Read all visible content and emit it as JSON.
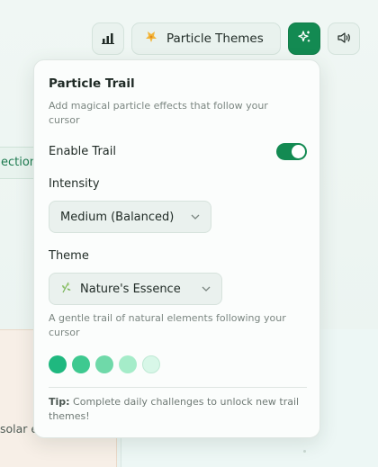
{
  "toolbar": {
    "theme_button_label": "Particle Themes",
    "icons": {
      "stats": "bar-chart-icon",
      "theme": "sparkle-star-icon",
      "particles": "magic-sparkles-icon",
      "sound": "speaker-icon"
    }
  },
  "background": {
    "pill_text": "ection",
    "body_snippet": "solar e"
  },
  "popover": {
    "title": "Particle Trail",
    "description": "Add magical particle effects that follow your cursor",
    "enable_label": "Enable Trail",
    "enable_on": true,
    "intensity_label": "Intensity",
    "intensity_value": "Medium (Balanced)",
    "theme_label": "Theme",
    "theme_value": "Nature's Essence",
    "theme_icon": "leaf-sprig-icon",
    "theme_description": "A gentle trail of natural elements following your cursor",
    "palette": [
      "#1fb87f",
      "#3ec990",
      "#6fd9a9",
      "#a5ecc9",
      "#d8f7e8"
    ],
    "tip_prefix": "Tip:",
    "tip_text": "Complete daily challenges to unlock new trail themes!"
  },
  "colors": {
    "accent": "#138a52",
    "toggle_on": "#138a52"
  }
}
